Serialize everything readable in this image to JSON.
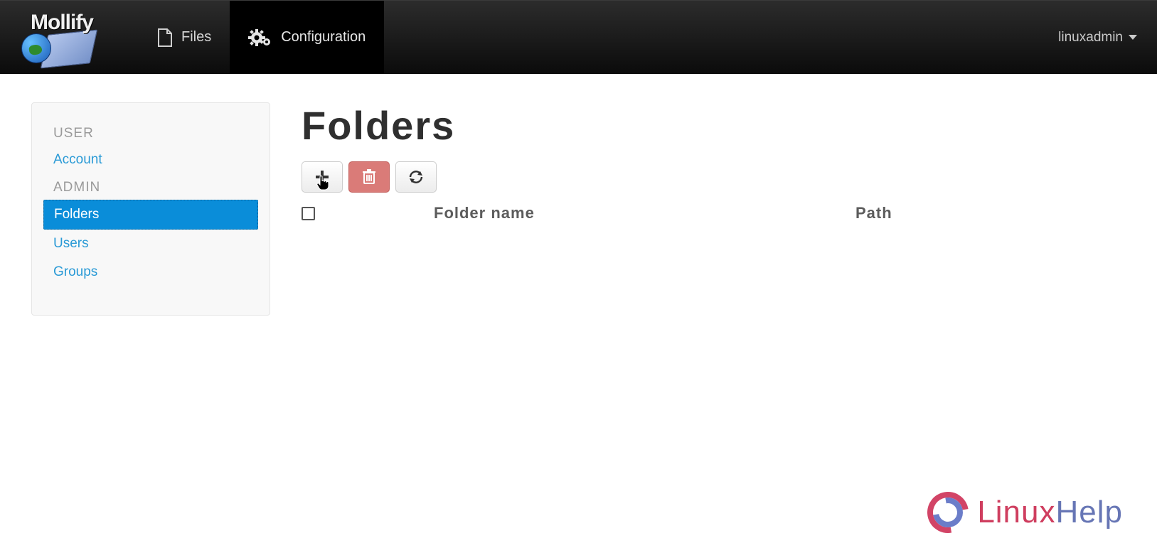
{
  "brand": {
    "name": "Mollify"
  },
  "nav": {
    "files_label": "Files",
    "config_label": "Configuration"
  },
  "user_menu": {
    "username": "linuxadmin"
  },
  "sidebar": {
    "section_user": "USER",
    "section_admin": "ADMIN",
    "account": "Account",
    "folders": "Folders",
    "users": "Users",
    "groups": "Groups"
  },
  "page": {
    "title": "Folders"
  },
  "table": {
    "col_name": "Folder name",
    "col_path": "Path"
  },
  "watermark": {
    "text_prefix": "Linux",
    "text_suffix": "Help"
  },
  "colors": {
    "accent": "#0a8dd9",
    "danger": "#da7b78"
  }
}
